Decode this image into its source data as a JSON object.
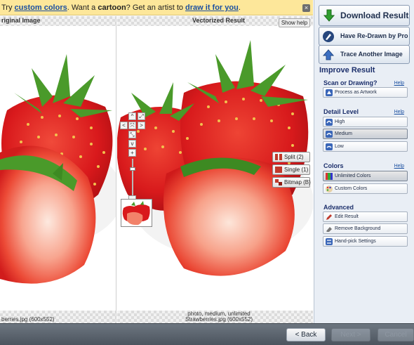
{
  "promo": {
    "pre": "Try ",
    "link1": "custom colors",
    "mid": ". Want a ",
    "bold": "cartoon",
    "mid2": "? Get an artist to ",
    "link2": "draw it for you",
    "end": ".",
    "close": "×"
  },
  "panes": {
    "original_caption": "riginal Image",
    "vectorized_caption": "Vectorized Result",
    "show_help": "Show help",
    "left_bottom": "berries.jpg (600x552)",
    "right_bottom_line1": "photo, medium, unlimited",
    "right_bottom_line2": "Strawberries.jpg (600x552)"
  },
  "zoom": {
    "up": "^",
    "left": "<",
    "fit": "⤧",
    "right": ">",
    "down": "v",
    "plus": "+",
    "minus": "−",
    "expand": "⤢",
    "shrink": "⤡"
  },
  "modes": [
    {
      "label": "Split (2)"
    },
    {
      "label": "Single (1)"
    },
    {
      "label": "Bitmap (B)"
    }
  ],
  "sidebar": {
    "download": "Download Result",
    "redraw": "Have Re-Drawn by Pro",
    "trace": "Trace Another Image",
    "improve": "Improve Result",
    "scan_title": "Scan or Drawing?",
    "scan_help": "Help",
    "scan_opt": "Process as Artwork",
    "detail_title": "Detail Level",
    "detail_help": "Help",
    "detail_opts": [
      "High",
      "Medium",
      "Low"
    ],
    "colors_title": "Colors",
    "colors_help": "Help",
    "colors_opts": [
      "Unlimited Colors",
      "Custom Colors"
    ],
    "advanced_title": "Advanced",
    "advanced_opts": [
      "Edit Result",
      "Remove Background",
      "Hand-pick Settings"
    ]
  },
  "nav": {
    "back": "< Back",
    "next": "Next >",
    "cancel": "Cancel"
  },
  "colors": {
    "strawberry_red": "#d9191c",
    "leaf_green": "#4a9a2a",
    "banner_yellow": "#fde79a",
    "accent_blue": "#1c2f6b"
  }
}
